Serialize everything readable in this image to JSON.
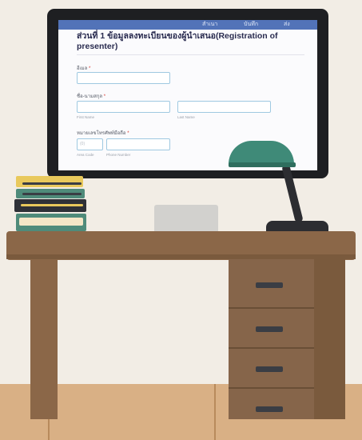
{
  "screen": {
    "topnav": [
      "สำเนา",
      "บันทึก",
      "ส่ง"
    ],
    "form_title": "ส่วนที่ 1 ข้อมูลลงทะเบียนของผู้นำเสนอ(Registration of presenter)",
    "fields": [
      {
        "label": "อีเมล",
        "required": "*"
      },
      {
        "label": "ชื่อ-นามสกุล",
        "required": "*",
        "sub_labels": [
          "First Name",
          "Last Name"
        ]
      },
      {
        "label": "หมายเลขโทรศัพท์มือถือ",
        "required": "*",
        "sub_labels": [
          "Area Code",
          "Phone Number"
        ],
        "area_placeholder": "(0)"
      }
    ]
  },
  "colors": {
    "topbar": "#5273b8",
    "input_border": "#9fc9e1",
    "lamp": "#3f8a78",
    "desk": "#8b6748",
    "monitor_frame": "#1e1f22"
  }
}
